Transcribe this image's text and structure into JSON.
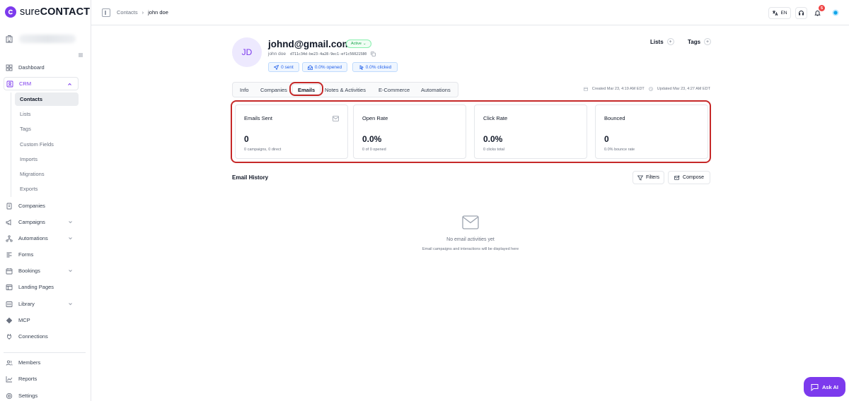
{
  "brand": {
    "name_light": "sure",
    "name_bold": "CONTACT",
    "accent": "#7c3aed"
  },
  "sidebar": {
    "items": [
      {
        "label": "Dashboard",
        "icon": "dashboard-icon"
      },
      {
        "label": "CRM",
        "icon": "crm-icon"
      },
      {
        "label": "Companies",
        "icon": "building-icon"
      },
      {
        "label": "Campaigns",
        "icon": "megaphone-icon"
      },
      {
        "label": "Automations",
        "icon": "workflow-icon"
      },
      {
        "label": "Forms",
        "icon": "form-icon"
      },
      {
        "label": "Bookings",
        "icon": "calendar-icon"
      },
      {
        "label": "Landing Pages",
        "icon": "layout-icon"
      },
      {
        "label": "Library",
        "icon": "library-icon"
      },
      {
        "label": "MCP",
        "icon": "mcp-icon"
      },
      {
        "label": "Connections",
        "icon": "plug-icon"
      },
      {
        "label": "Members",
        "icon": "users-icon"
      },
      {
        "label": "Reports",
        "icon": "chart-icon"
      },
      {
        "label": "Settings",
        "icon": "gear-icon"
      }
    ],
    "crm_sub": [
      "Contacts",
      "Lists",
      "Tags",
      "Custom Fields",
      "Imports",
      "Migrations",
      "Exports"
    ]
  },
  "topbar": {
    "breadcrumb": [
      "Contacts",
      "john doe"
    ],
    "lang": "EN",
    "notif_count": "5"
  },
  "contact": {
    "initials": "JD",
    "email": "johnd@gmail.com",
    "status": "Active",
    "name": "john doe",
    "id": "d711c34d-be23-4a28-9ec1-ef1c56021580",
    "chips": [
      "0 sent",
      "0.0% opened",
      "0.0% clicked"
    ],
    "lists_label": "Lists",
    "tags_label": "Tags",
    "created": "Created Mar 23, 4:19 AM EDT",
    "updated": "Updated Mar 23, 4:27 AM EDT"
  },
  "tabs": [
    "Info",
    "Companies",
    "Emails",
    "Notes & Activities",
    "E-Commerce",
    "Automations"
  ],
  "stats": [
    {
      "label": "Emails Sent",
      "value": "0",
      "sub": "0 campaigns, 0 direct"
    },
    {
      "label": "Open Rate",
      "value": "0.0%",
      "sub": "0 of 0 opened"
    },
    {
      "label": "Click Rate",
      "value": "0.0%",
      "sub": "0 clicks total"
    },
    {
      "label": "Bounced",
      "value": "0",
      "sub": "0.0% bounce rate"
    }
  ],
  "history": {
    "title": "Email History",
    "filters": "Filters",
    "compose": "Compose",
    "empty_title": "No email activities yet",
    "empty_sub": "Email campaigns and interactions will be displayed here"
  },
  "ask_ai": "Ask AI"
}
